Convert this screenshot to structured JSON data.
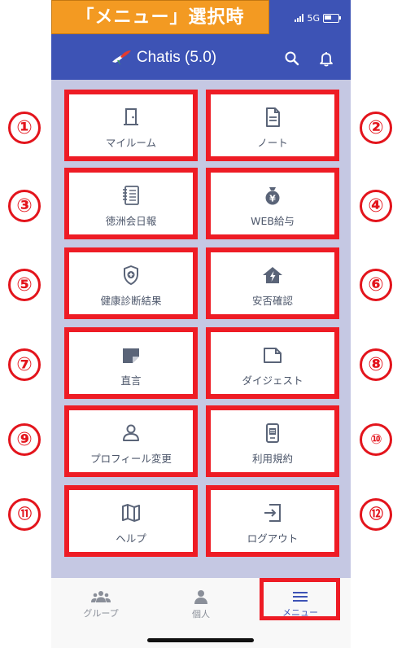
{
  "banner": {
    "text": "「メニュー」選択時"
  },
  "status": {
    "network": "5G"
  },
  "app_bar": {
    "title": "Chatis (5.0)",
    "search_icon": "search-icon",
    "bell_icon": "bell-icon"
  },
  "tiles": [
    {
      "label": "マイルーム",
      "icon": "door-icon"
    },
    {
      "label": "ノート",
      "icon": "document-icon"
    },
    {
      "label": "徳洲会日報",
      "icon": "notebook-icon"
    },
    {
      "label": "WEB給与",
      "icon": "money-bag-icon"
    },
    {
      "label": "健康診断結果",
      "icon": "shield-plus-icon"
    },
    {
      "label": "安否確認",
      "icon": "house-alert-icon"
    },
    {
      "label": "直言",
      "icon": "folded-note-icon"
    },
    {
      "label": "ダイジェスト",
      "icon": "folded-note-outline-icon"
    },
    {
      "label": "プロフィール変更",
      "icon": "person-icon"
    },
    {
      "label": "利用規約",
      "icon": "phone-list-icon"
    },
    {
      "label": "ヘルプ",
      "icon": "map-icon"
    },
    {
      "label": "ログアウト",
      "icon": "logout-icon"
    }
  ],
  "numbers": [
    "①",
    "②",
    "③",
    "④",
    "⑤",
    "⑥",
    "⑦",
    "⑧",
    "⑨",
    "⑩",
    "⑪",
    "⑫"
  ],
  "bottom_nav": {
    "items": [
      {
        "label": "グループ",
        "icon": "group-icon"
      },
      {
        "label": "個人",
        "icon": "person-icon"
      },
      {
        "label": "メニュー",
        "icon": "menu-icon"
      }
    ]
  },
  "colors": {
    "primary": "#3d53b5",
    "annotation": "#ee1c25",
    "banner": "#f39a22",
    "background": "#c5c8e3"
  }
}
